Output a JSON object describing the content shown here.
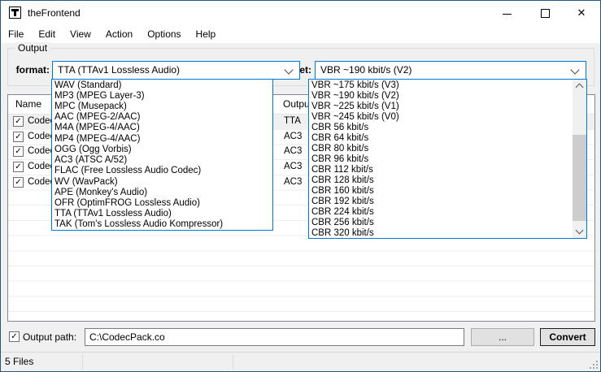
{
  "window": {
    "title": "theFrontend"
  },
  "icons": {
    "check": "✓",
    "close": "✕"
  },
  "menu": {
    "items": [
      "File",
      "Edit",
      "View",
      "Action",
      "Options",
      "Help"
    ]
  },
  "output_group": {
    "label": "Output",
    "format_label": "format:",
    "format_value": "TTA (TTAv1 Lossless Audio)",
    "preset_label": "preset:",
    "preset_value": "VBR ~190 kbit/s (V2)"
  },
  "format_dropdown": {
    "selected": "TTA (TTAv1 Lossless Audio)",
    "items": [
      "WAV (Standard)",
      "MP3 (MPEG Layer-3)",
      "MPC (Musepack)",
      "AAC (MPEG-2/AAC)",
      "M4A (MPEG-4/AAC)",
      "MP4 (MPEG-4/AAC)",
      "OGG (Ogg Vorbis)",
      "AC3 (ATSC A/52)",
      "FLAC (Free Lossless Audio Codec)",
      "WV (WavPack)",
      "APE (Monkey's Audio)",
      "OFR (OptimFROG Lossless Audio)",
      "TTA (TTAv1 Lossless Audio)",
      "TAK (Tom's Lossless Audio Kompressor)"
    ]
  },
  "preset_dropdown": {
    "selected": "VBR ~190 kbit/s (V2)",
    "items": [
      "VBR ~175 kbit/s (V3)",
      "VBR ~190 kbit/s (V2)",
      "VBR ~225 kbit/s (V1)",
      "VBR ~245 kbit/s (V0)",
      "CBR 56 kbit/s",
      "CBR 64 kbit/s",
      "CBR 80 kbit/s",
      "CBR 96 kbit/s",
      "CBR 112 kbit/s",
      "CBR 128 kbit/s",
      "CBR 160 kbit/s",
      "CBR 192 kbit/s",
      "CBR 224 kbit/s",
      "CBR 256 kbit/s",
      "CBR 320 kbit/s"
    ]
  },
  "file_list": {
    "columns": {
      "name": "Name",
      "output": "Output"
    },
    "rows": [
      {
        "checked": true,
        "selected": true,
        "name": "CodecP",
        "output": "TTA"
      },
      {
        "checked": true,
        "selected": false,
        "name": "CodecP",
        "output": "AC3"
      },
      {
        "checked": true,
        "selected": false,
        "name": "CodecP",
        "output": "AC3"
      },
      {
        "checked": true,
        "selected": false,
        "name": "CodecP",
        "output": "AC3"
      },
      {
        "checked": true,
        "selected": false,
        "name": "CodecP",
        "output": "AC3"
      }
    ]
  },
  "output_path": {
    "checkbox_checked": true,
    "label": "Output path:",
    "value": "C:\\CodecPack.co",
    "browse_label": "...",
    "convert_label": "Convert"
  },
  "status_bar": {
    "files": "5 Files"
  },
  "colors": {
    "focus_border": "#0078d7",
    "window_border": "#26567f",
    "client_bg": "#f0f0f0",
    "selected_row_bg": "#f0f0f0",
    "scrollbar_thumb": "#cdcdcd"
  }
}
